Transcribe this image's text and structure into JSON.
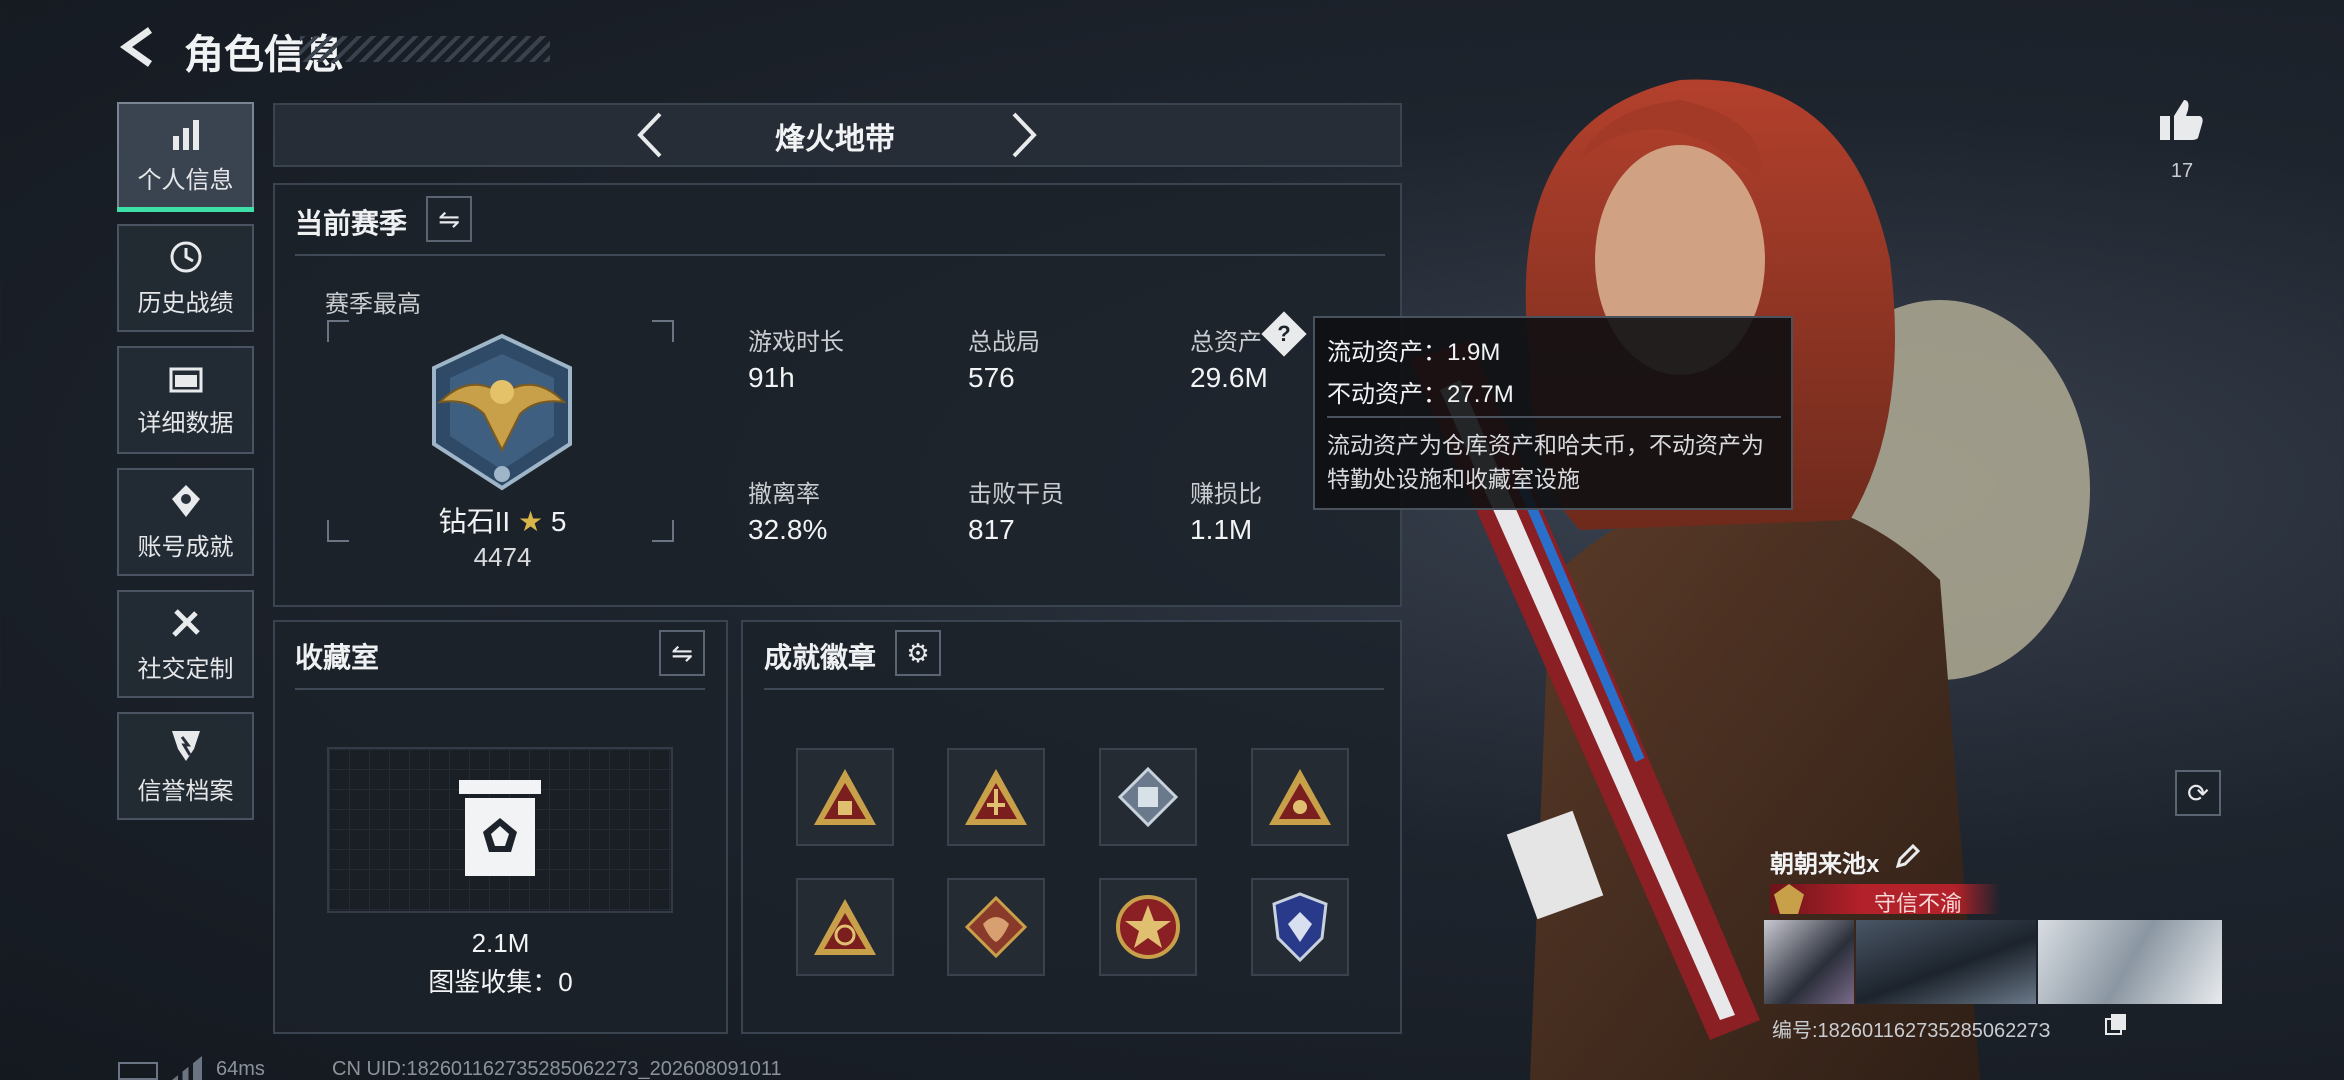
{
  "header": {
    "title": "角色信息"
  },
  "sidebar": {
    "items": [
      {
        "label": "个人信息",
        "icon": "bar-chart-icon",
        "active": true
      },
      {
        "label": "历史战绩",
        "icon": "clock-history-icon"
      },
      {
        "label": "详细数据",
        "icon": "folder-icon"
      },
      {
        "label": "账号成就",
        "icon": "achievement-icon"
      },
      {
        "label": "社交定制",
        "icon": "tools-icon"
      },
      {
        "label": "信誉档案",
        "icon": "shield-icon"
      }
    ]
  },
  "mode_switcher": {
    "label": "烽火地带"
  },
  "season": {
    "title": "当前赛季",
    "peak_label": "赛季最高",
    "rank_name": "钻石II",
    "rank_stars": "5",
    "rank_score": "4474",
    "stats": [
      {
        "label": "游戏时长",
        "value": "91h"
      },
      {
        "label": "总战局",
        "value": "576"
      },
      {
        "label": "总资产",
        "value": "29.6M"
      },
      {
        "label": "撤离率",
        "value": "32.8%"
      },
      {
        "label": "击败干员",
        "value": "817"
      },
      {
        "label": "赚损比",
        "value": "1.1M"
      }
    ]
  },
  "tooltip": {
    "liquid": "流动资产：1.9M",
    "fixed": "不动资产：27.7M",
    "desc": "流动资产为仓库资产和哈夫币，不动资产为特勤处设施和收藏室设施"
  },
  "collection": {
    "title": "收藏室",
    "value": "2.1M",
    "catalog": "图鉴收集：0"
  },
  "achievements": {
    "title": "成就徽章"
  },
  "likes": {
    "count": "17"
  },
  "player": {
    "name": "朝朝来池x",
    "tag": "守信不渝",
    "id": "编号:18260116273528506227З"
  },
  "footer": {
    "ping": "64ms",
    "uid": "CN UID:182601162735285062273_202608091011"
  },
  "colors": {
    "accent": "#3de0a6",
    "tag_red": "#b3212a",
    "badge_gold": "#c9a04a"
  }
}
